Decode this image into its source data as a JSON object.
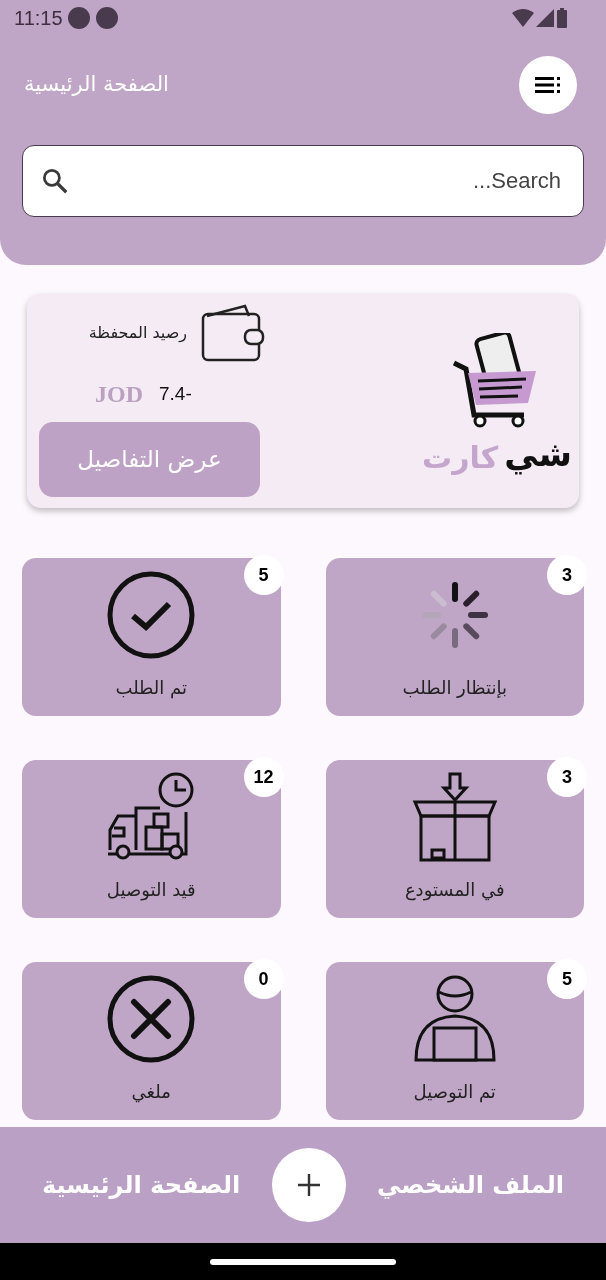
{
  "status_bar": {
    "time": "11:15"
  },
  "header": {
    "title": "الصفحة الرئيسية"
  },
  "search": {
    "placeholder": "Search..."
  },
  "wallet": {
    "label": "رصيد المحفظة",
    "amount": "7.4-",
    "currency": "JOD",
    "button": "عرض التفاصيل",
    "logo_word_1": "شي",
    "logo_word_2": "كارت"
  },
  "tiles": [
    {
      "kind": "pending",
      "label": "بإنتظار الطلب",
      "count": "3"
    },
    {
      "kind": "done",
      "label": "تم الطلب",
      "count": "5"
    },
    {
      "kind": "warehouse",
      "label": "في المستودع",
      "count": "3"
    },
    {
      "kind": "delivering",
      "label": "قيد التوصيل",
      "count": "12"
    },
    {
      "kind": "delivered",
      "label": "تم التوصيل",
      "count": "5"
    },
    {
      "kind": "cancelled",
      "label": "ملغي",
      "count": "0"
    }
  ],
  "bottom_nav": {
    "right": "الملف الشخصي",
    "left": "الصفحة الرئيسية"
  }
}
